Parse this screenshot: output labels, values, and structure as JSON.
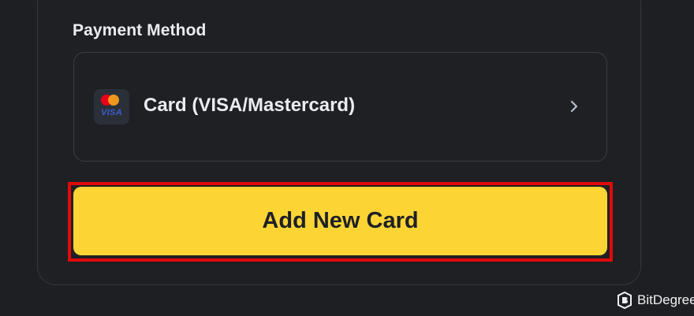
{
  "payment": {
    "section_label": "Payment Method",
    "selected_method": {
      "label": "Card (VISA/Mastercard)",
      "icon": "visa-mastercard-icon",
      "icon_text": "VISA"
    },
    "chevron_icon": "chevron-right-icon"
  },
  "actions": {
    "add_card_label": "Add New Card",
    "highlight_color": "#e10a0a",
    "button_color": "#fcd535"
  },
  "watermark": {
    "text": "BitDegree",
    "icon": "bitdegree-logo-icon"
  }
}
